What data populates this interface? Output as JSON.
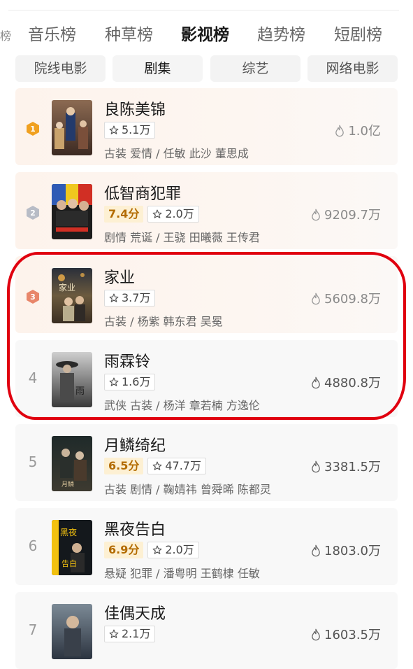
{
  "tabs": [
    {
      "label": "音乐榜",
      "active": false
    },
    {
      "label": "种草榜",
      "active": false
    },
    {
      "label": "影视榜",
      "active": true
    },
    {
      "label": "趋势榜",
      "active": false
    },
    {
      "label": "短剧榜",
      "active": false
    }
  ],
  "edge_fragment": "榜",
  "subtabs": [
    {
      "label": "院线电影",
      "active": false
    },
    {
      "label": "剧集",
      "active": true
    },
    {
      "label": "综艺",
      "active": false
    },
    {
      "label": "网络电影",
      "active": false
    }
  ],
  "items": [
    {
      "rank": "1",
      "title": "良陈美锦",
      "score": null,
      "favorites": "5.1万",
      "meta": "古装 爱情 / 任敏 此沙 董思成",
      "heat": "1.0亿"
    },
    {
      "rank": "2",
      "title": "低智商犯罪",
      "score": "7.4分",
      "favorites": "2.0万",
      "meta": "剧情 荒诞 / 王骁 田曦薇 王传君",
      "heat": "9209.7万"
    },
    {
      "rank": "3",
      "title": "家业",
      "score": null,
      "favorites": "3.7万",
      "meta": "古装 / 杨紫 韩东君 吴冕",
      "heat": "5609.8万"
    },
    {
      "rank": "4",
      "title": "雨霖铃",
      "score": null,
      "favorites": "1.6万",
      "meta": "武侠 古装 / 杨洋 章若楠 方逸伦",
      "heat": "4880.8万"
    },
    {
      "rank": "5",
      "title": "月鳞绮纪",
      "score": "6.5分",
      "favorites": "47.7万",
      "meta": "古装 剧情 / 鞠婧祎 曾舜晞 陈都灵",
      "heat": "3381.5万"
    },
    {
      "rank": "6",
      "title": "黑夜告白",
      "score": "6.9分",
      "favorites": "2.0万",
      "meta": "悬疑 犯罪 / 潘粤明 王鹤棣 任敏",
      "heat": "1803.0万"
    },
    {
      "rank": "7",
      "title": "佳偶天成",
      "score": null,
      "favorites": "2.1万",
      "meta": "",
      "heat": "1603.5万"
    }
  ],
  "colors": {
    "highlight_circle": "#e0000f",
    "gold_badge": "#f0a020",
    "silver_badge": "#b8bcc6",
    "bronze_badge": "#e8866a",
    "score_bg": "#fdf0d3",
    "score_text": "#b36b00"
  },
  "icons": {
    "favorite": "star-outline-icon",
    "heat": "flame-icon",
    "top_rank": "hexagon-badge-icon"
  }
}
